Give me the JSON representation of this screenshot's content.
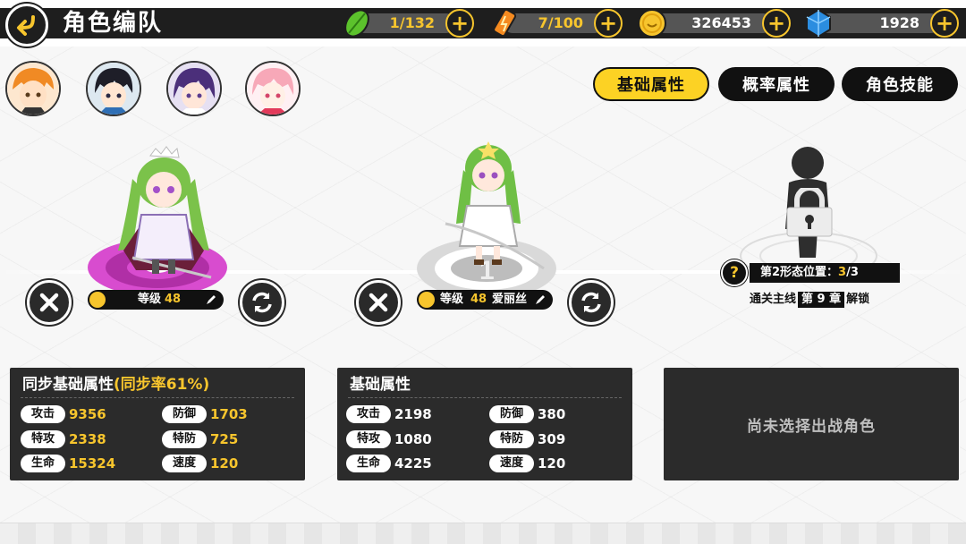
{
  "header": {
    "title": "角色编队",
    "resources": [
      {
        "icon": "stamina-leaf-icon",
        "value": "1/132"
      },
      {
        "icon": "battery-energy-icon",
        "value": "7/100"
      },
      {
        "icon": "gold-coin-icon",
        "value": "326453"
      },
      {
        "icon": "blue-crystal-icon",
        "value": "1928"
      }
    ]
  },
  "tabs": [
    {
      "label": "基础属性",
      "active": true
    },
    {
      "label": "概率属性",
      "active": false
    },
    {
      "label": "角色技能",
      "active": false
    }
  ],
  "slots": [
    {
      "level_label": "等级",
      "level": "48",
      "name": ""
    },
    {
      "level_label": "等级",
      "level": "48",
      "name": "爱丽丝"
    }
  ],
  "locked_slot": {
    "form_label": "第2形态位置：",
    "form_current": "3",
    "form_total": "/3",
    "unlock_prefix": "通关主线",
    "unlock_chapter": "第 9 章",
    "unlock_suffix": "解锁"
  },
  "panels": [
    {
      "title": "同步基础属性",
      "title_extra": "(同步率61%)",
      "stats": [
        {
          "label": "攻击",
          "value": "9356"
        },
        {
          "label": "防御",
          "value": "1703"
        },
        {
          "label": "特攻",
          "value": "2338"
        },
        {
          "label": "特防",
          "value": "725"
        },
        {
          "label": "生命",
          "value": "15324"
        },
        {
          "label": "速度",
          "value": "120"
        }
      ]
    },
    {
      "title": "基础属性",
      "stats": [
        {
          "label": "攻击",
          "value": "2198"
        },
        {
          "label": "防御",
          "value": "380"
        },
        {
          "label": "特攻",
          "value": "1080"
        },
        {
          "label": "特防",
          "value": "309"
        },
        {
          "label": "生命",
          "value": "4225"
        },
        {
          "label": "速度",
          "value": "120"
        }
      ]
    },
    {
      "empty_message": "尚未选择出战角色"
    }
  ],
  "colors": {
    "accent": "#f7c52d",
    "dark": "#1e1e1e",
    "panel": "#2b2b2b",
    "tab_active": "#fcd224"
  }
}
